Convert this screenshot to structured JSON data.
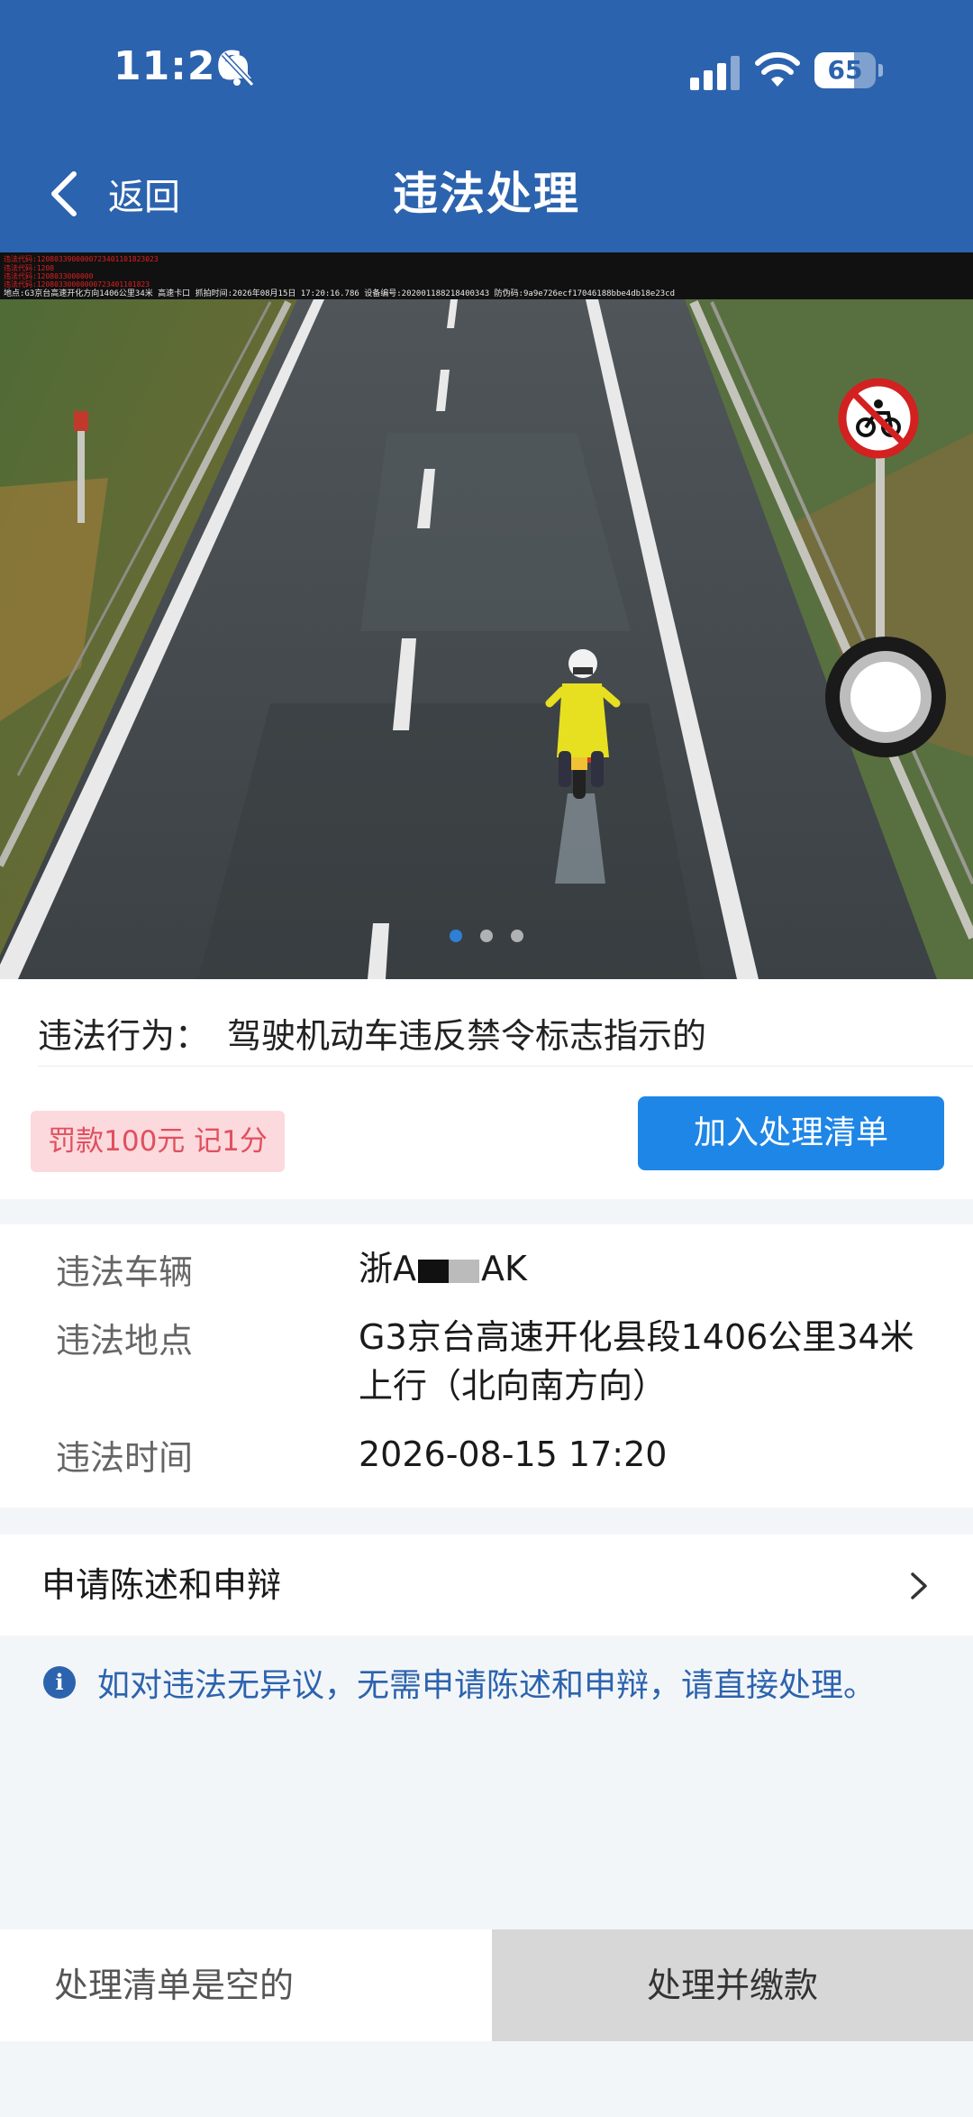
{
  "status_bar": {
    "time": "11:26",
    "battery": "65",
    "battery_fraction": 0.65,
    "icons": [
      "bell-off-icon",
      "signal-icon",
      "wifi-icon",
      "battery-icon"
    ]
  },
  "header": {
    "back_label": "返回",
    "title": "违法处理",
    "background": "#2c63ae"
  },
  "photo": {
    "overlay_lines_red": [
      "违法代码:1208033900000723401101823023",
      "违法代码:1208",
      "违法代码:1208033000000",
      "违法代码:12080330000000723401101823"
    ],
    "overlay_line_white": "地点:G3京台高速开化方向1406公里34米 高速卡口 抓拍时间:2026年08月15日 17:20:16.786 设备编号:202001188218400343 防伪码:9a9e726ecf17046188bbe4db18e23cd",
    "dots": [
      true,
      false,
      false
    ],
    "sign": "no-motorcycle-sign"
  },
  "violation": {
    "behavior_label": "违法行为：",
    "behavior_value": "驾驶机动车违反禁令标志指示的",
    "penalty": "罚款100元 记1分",
    "add_button": "加入处理清单"
  },
  "details": {
    "vehicle_label": "违法车辆",
    "vehicle_prefix": "浙A",
    "vehicle_suffix": "AK",
    "location_label": "违法地点",
    "location_line1": "G3京台高速开化县段1406公里34米",
    "location_line2": "上行（北向南方向）",
    "time_label": "违法时间",
    "time_value": "2026-08-15 17:20"
  },
  "appeal": {
    "label": "申请陈述和申辩"
  },
  "info": {
    "icon_glyph": "i",
    "text": "如对违法无异议，无需申请陈述和申辩，请直接处理。"
  },
  "bottom": {
    "list_status": "处理清单是空的",
    "pay_button": "处理并缴款"
  },
  "colors": {
    "primary": "#2c63ae",
    "button_blue": "#1e86e6",
    "penalty_bg": "#fcd9dd",
    "penalty_text": "#e0505e"
  }
}
